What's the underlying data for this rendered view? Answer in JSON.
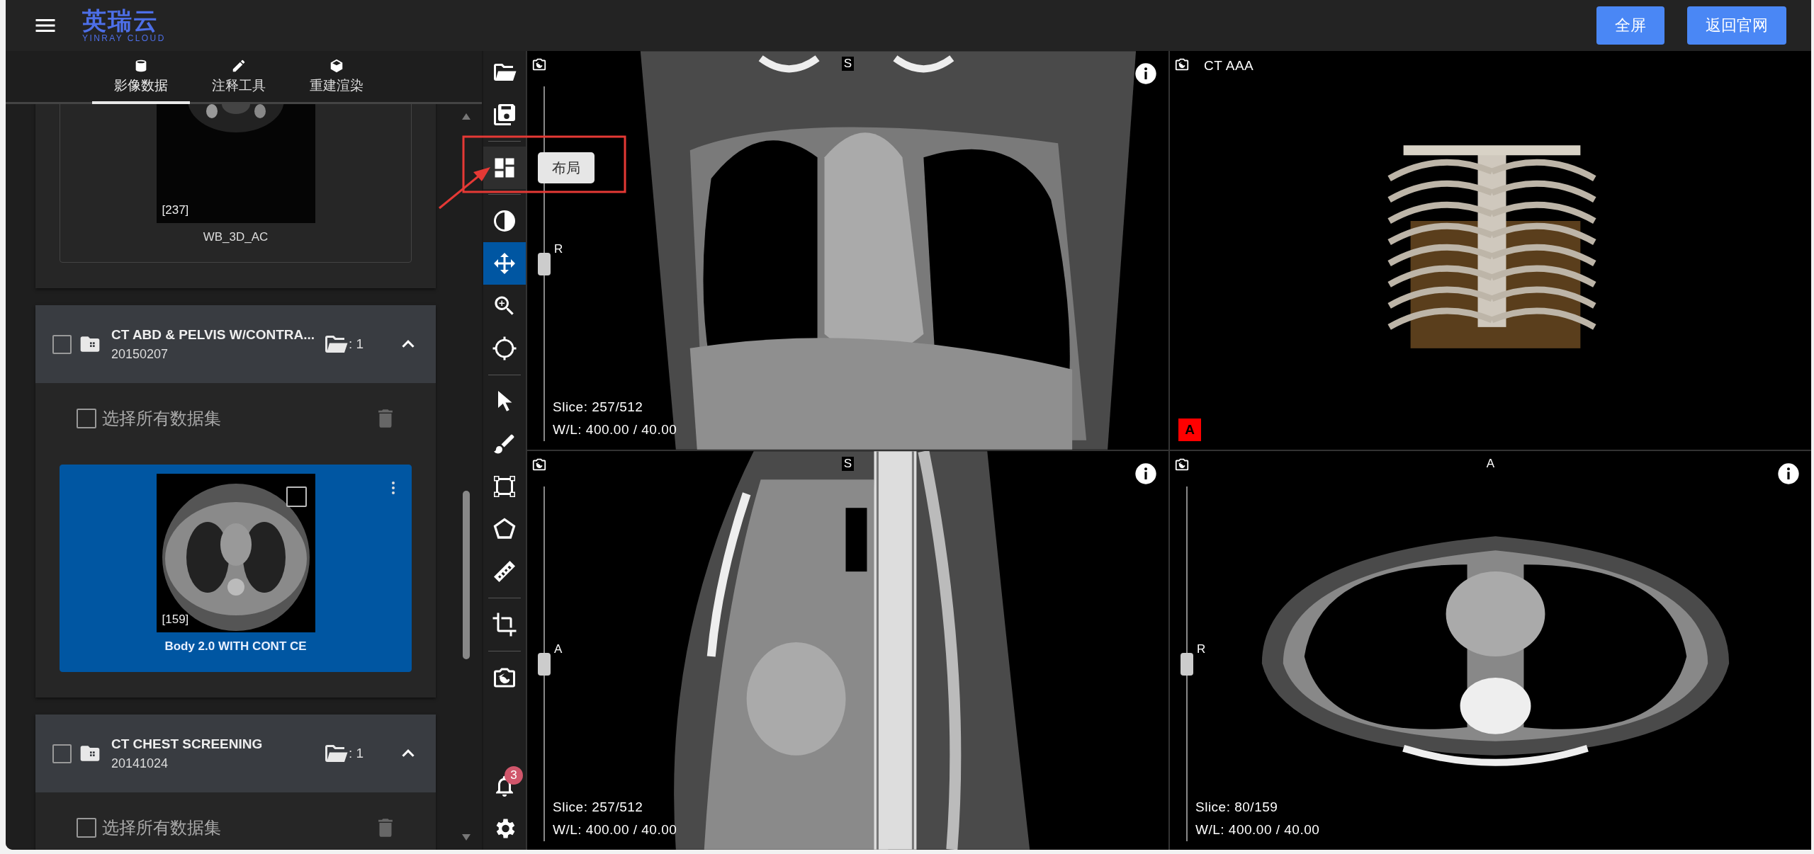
{
  "header": {
    "logo": "英瑞云",
    "logo_subtitle": "YINRAY CLOUD",
    "buttons": [
      "全屏",
      "返回官网"
    ]
  },
  "sidebar": {
    "tabs": [
      {
        "label": "影像数据",
        "kind": "database",
        "selected": true
      },
      {
        "label": "注释工具",
        "kind": "pencil",
        "selected": false
      },
      {
        "label": "重建渲染",
        "kind": "cube",
        "selected": false
      }
    ],
    "studies": [
      {
        "series": [
          {
            "kind": "pet",
            "count": "[237]",
            "name": "WB_3D_AC",
            "selected": false
          }
        ]
      },
      {
        "title": "CT ABD & PELVIS W/CONTRA...",
        "date": "20150207",
        "checked": false,
        "expanded": true,
        "folder_count": ": 1",
        "select_all": "选择所有数据集",
        "select_all_checked": false,
        "series": [
          {
            "kind": "ct-axial",
            "count": "[159]",
            "name": "Body 2.0 WITH CONT CE",
            "selected": true,
            "checked": false
          }
        ]
      },
      {
        "title": "CT CHEST SCREENING",
        "date": "20141024",
        "checked": false,
        "expanded": true,
        "folder_count": ": 1",
        "select_all": "选择所有数据集",
        "select_all_checked": false
      }
    ]
  },
  "toolbar": {
    "groups": [
      [
        {
          "kind": "open",
          "selected": false
        },
        {
          "kind": "save",
          "selected": false
        }
      ],
      [
        {
          "kind": "layout",
          "selected": false,
          "hovered": true,
          "tooltip": "布局"
        }
      ],
      [
        {
          "kind": "contrast",
          "selected": false
        },
        {
          "kind": "pan",
          "selected": true
        },
        {
          "kind": "zoom",
          "selected": false
        },
        {
          "kind": "crosshair",
          "selected": false
        }
      ],
      [
        {
          "kind": "pointer",
          "selected": false
        },
        {
          "kind": "brush",
          "selected": false
        },
        {
          "kind": "rectangle",
          "selected": false
        },
        {
          "kind": "polygon",
          "selected": false
        },
        {
          "kind": "ruler",
          "selected": false
        }
      ],
      [
        {
          "kind": "crop",
          "selected": false
        }
      ],
      [
        {
          "kind": "camera-sync",
          "selected": false
        }
      ]
    ],
    "notifications": {
      "badge": "3"
    }
  },
  "viewports": [
    {
      "kind": "coronal",
      "top_label": "S",
      "side_label": "R",
      "slice": "Slice: 257/512",
      "window_level": "W/L: 400.00 / 40.00",
      "level": 0.5
    },
    {
      "kind": "volume",
      "title": "CT AAA",
      "marker": "A"
    },
    {
      "kind": "sagittal",
      "top_label": "S",
      "side_label": "A",
      "slice": "Slice: 257/512",
      "window_level": "W/L: 400.00 / 40.00",
      "level": 0.5
    },
    {
      "kind": "axial",
      "top_label": "A",
      "side_label": "R",
      "slice": "Slice: 80/159",
      "window_level": "W/L: 400.00 / 40.00",
      "level": 0.5
    }
  ]
}
